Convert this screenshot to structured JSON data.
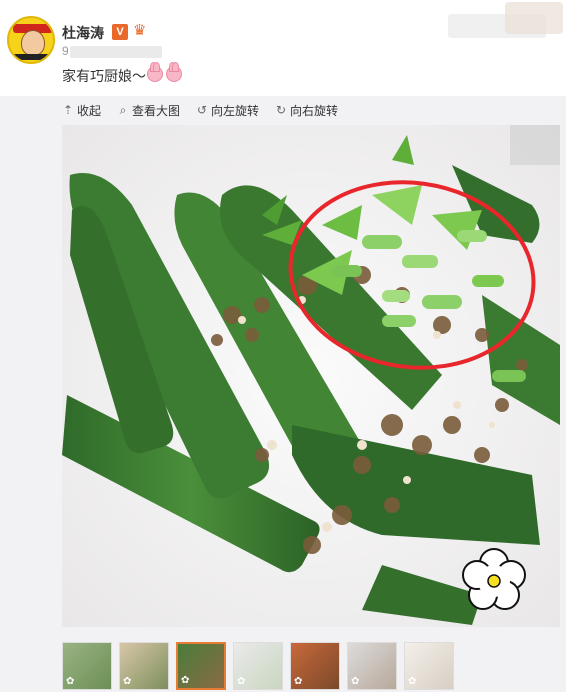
{
  "post": {
    "author": "杜海涛",
    "verified_badge": "V",
    "meta_first_char": "9",
    "text": "家有巧厨娘～"
  },
  "toolbar": {
    "collapse": "收起",
    "view_large": "查看大图",
    "rotate_left": "向左旋转",
    "rotate_right": "向右旋转"
  },
  "icons": {
    "collapse": "collapse-arrow-icon",
    "view_large": "magnifier-icon",
    "rotate_left": "rotate-left-icon",
    "rotate_right": "rotate-right-icon",
    "verified": "verified-v-icon",
    "vip": "crown-icon",
    "emoji": "pig-emoji-icon"
  },
  "colors": {
    "verified_badge": "#e9692b",
    "active_thumb_border": "#e57d35",
    "annotation_circle": "#e8262b"
  },
  "thumbnails": {
    "count": 7,
    "active_index": 2
  }
}
